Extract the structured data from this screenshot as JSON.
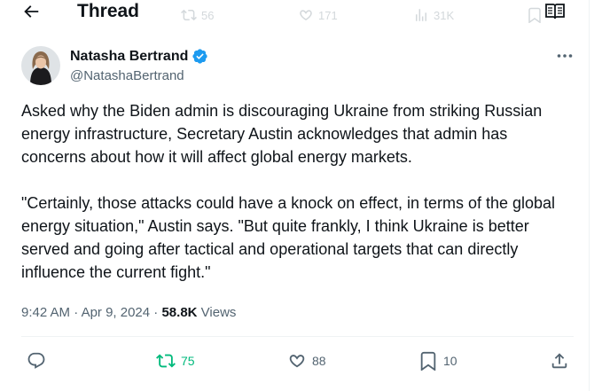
{
  "header": {
    "title": "Thread",
    "ghost_retweets": "56",
    "ghost_likes": "171",
    "ghost_views": "31K"
  },
  "author": {
    "name": "Natasha Bertrand",
    "handle": "@NatashaBertrand",
    "verified": true
  },
  "tweet": {
    "paragraph1": "Asked why the Biden admin is discouraging Ukraine from striking Russian energy infrastructure, Secretary Austin acknowledges that admin has concerns about how it will affect global energy markets.",
    "paragraph2": "\"Certainly, those attacks could have a knock on effect, in terms of the global energy situation,\" Austin says. \"But quite frankly, I think Ukraine is better served and going after tactical and operational targets that can directly influence the current fight.\"",
    "time": "9:42 AM",
    "date": "Apr 9, 2024",
    "separator": "·",
    "views_count": "58.8K",
    "views_label": "Views"
  },
  "actions": {
    "replies": "",
    "retweets": "75",
    "likes": "88",
    "bookmarks": "10"
  },
  "colors": {
    "text": "#0f1419",
    "secondary": "#536471",
    "retweet": "#00ba7c",
    "verified": "#1d9bf0"
  }
}
